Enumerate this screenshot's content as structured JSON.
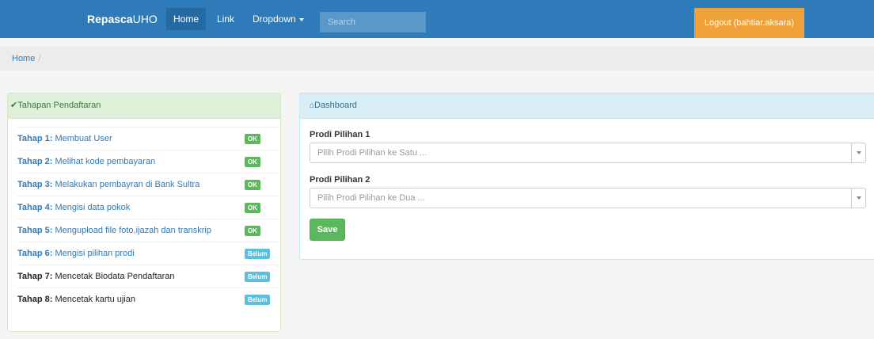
{
  "navbar": {
    "brand_bold": "Repasca",
    "brand_rest": "UHO",
    "items": [
      {
        "label": "Home"
      },
      {
        "label": "Link"
      },
      {
        "label": "Dropdown"
      }
    ],
    "search_placeholder": "Search",
    "logout_label": "Logout (bahtiar.aksara)",
    "colors": {
      "navbar": "#2f7ab8",
      "logout": "#f0a23a"
    }
  },
  "breadcrumb": {
    "home": "Home",
    "separator": "/"
  },
  "tahapan": {
    "heading": "Tahapan Pendaftaran",
    "steps": [
      {
        "step": "Tahap 1:",
        "text": "Membuat User",
        "status": "OK"
      },
      {
        "step": "Tahap 2:",
        "text": "Melihat kode pembayaran",
        "status": "OK"
      },
      {
        "step": "Tahap 3:",
        "text": "Melakukan pembayran di Bank Sultra",
        "status": "OK"
      },
      {
        "step": "Tahap 4:",
        "text": "Mengisi data pokok",
        "status": "OK"
      },
      {
        "step": "Tahap 5:",
        "text": "Mengupload file foto,ijazah dan transkrip",
        "status": "OK"
      },
      {
        "step": "Tahap 6:",
        "text": "Mengisi pilihan prodi",
        "status": "Belum"
      },
      {
        "step": "Tahap 7:",
        "text": "Mencetak Biodata Pendaftaran",
        "status": "Belum"
      },
      {
        "step": "Tahap 8:",
        "text": "Mencetak kartu ujian",
        "status": "Belum"
      }
    ]
  },
  "dashboard": {
    "heading": "Dashboard",
    "prodi1_label": "Prodi Pilihan 1",
    "prodi1_placeholder": "Pilih Prodi Pilihan ke Satu ...",
    "prodi2_label": "Prodi Pilihan 2",
    "prodi2_placeholder": "Pilih Prodi Pilihan ke Dua ...",
    "save_label": "Save"
  }
}
